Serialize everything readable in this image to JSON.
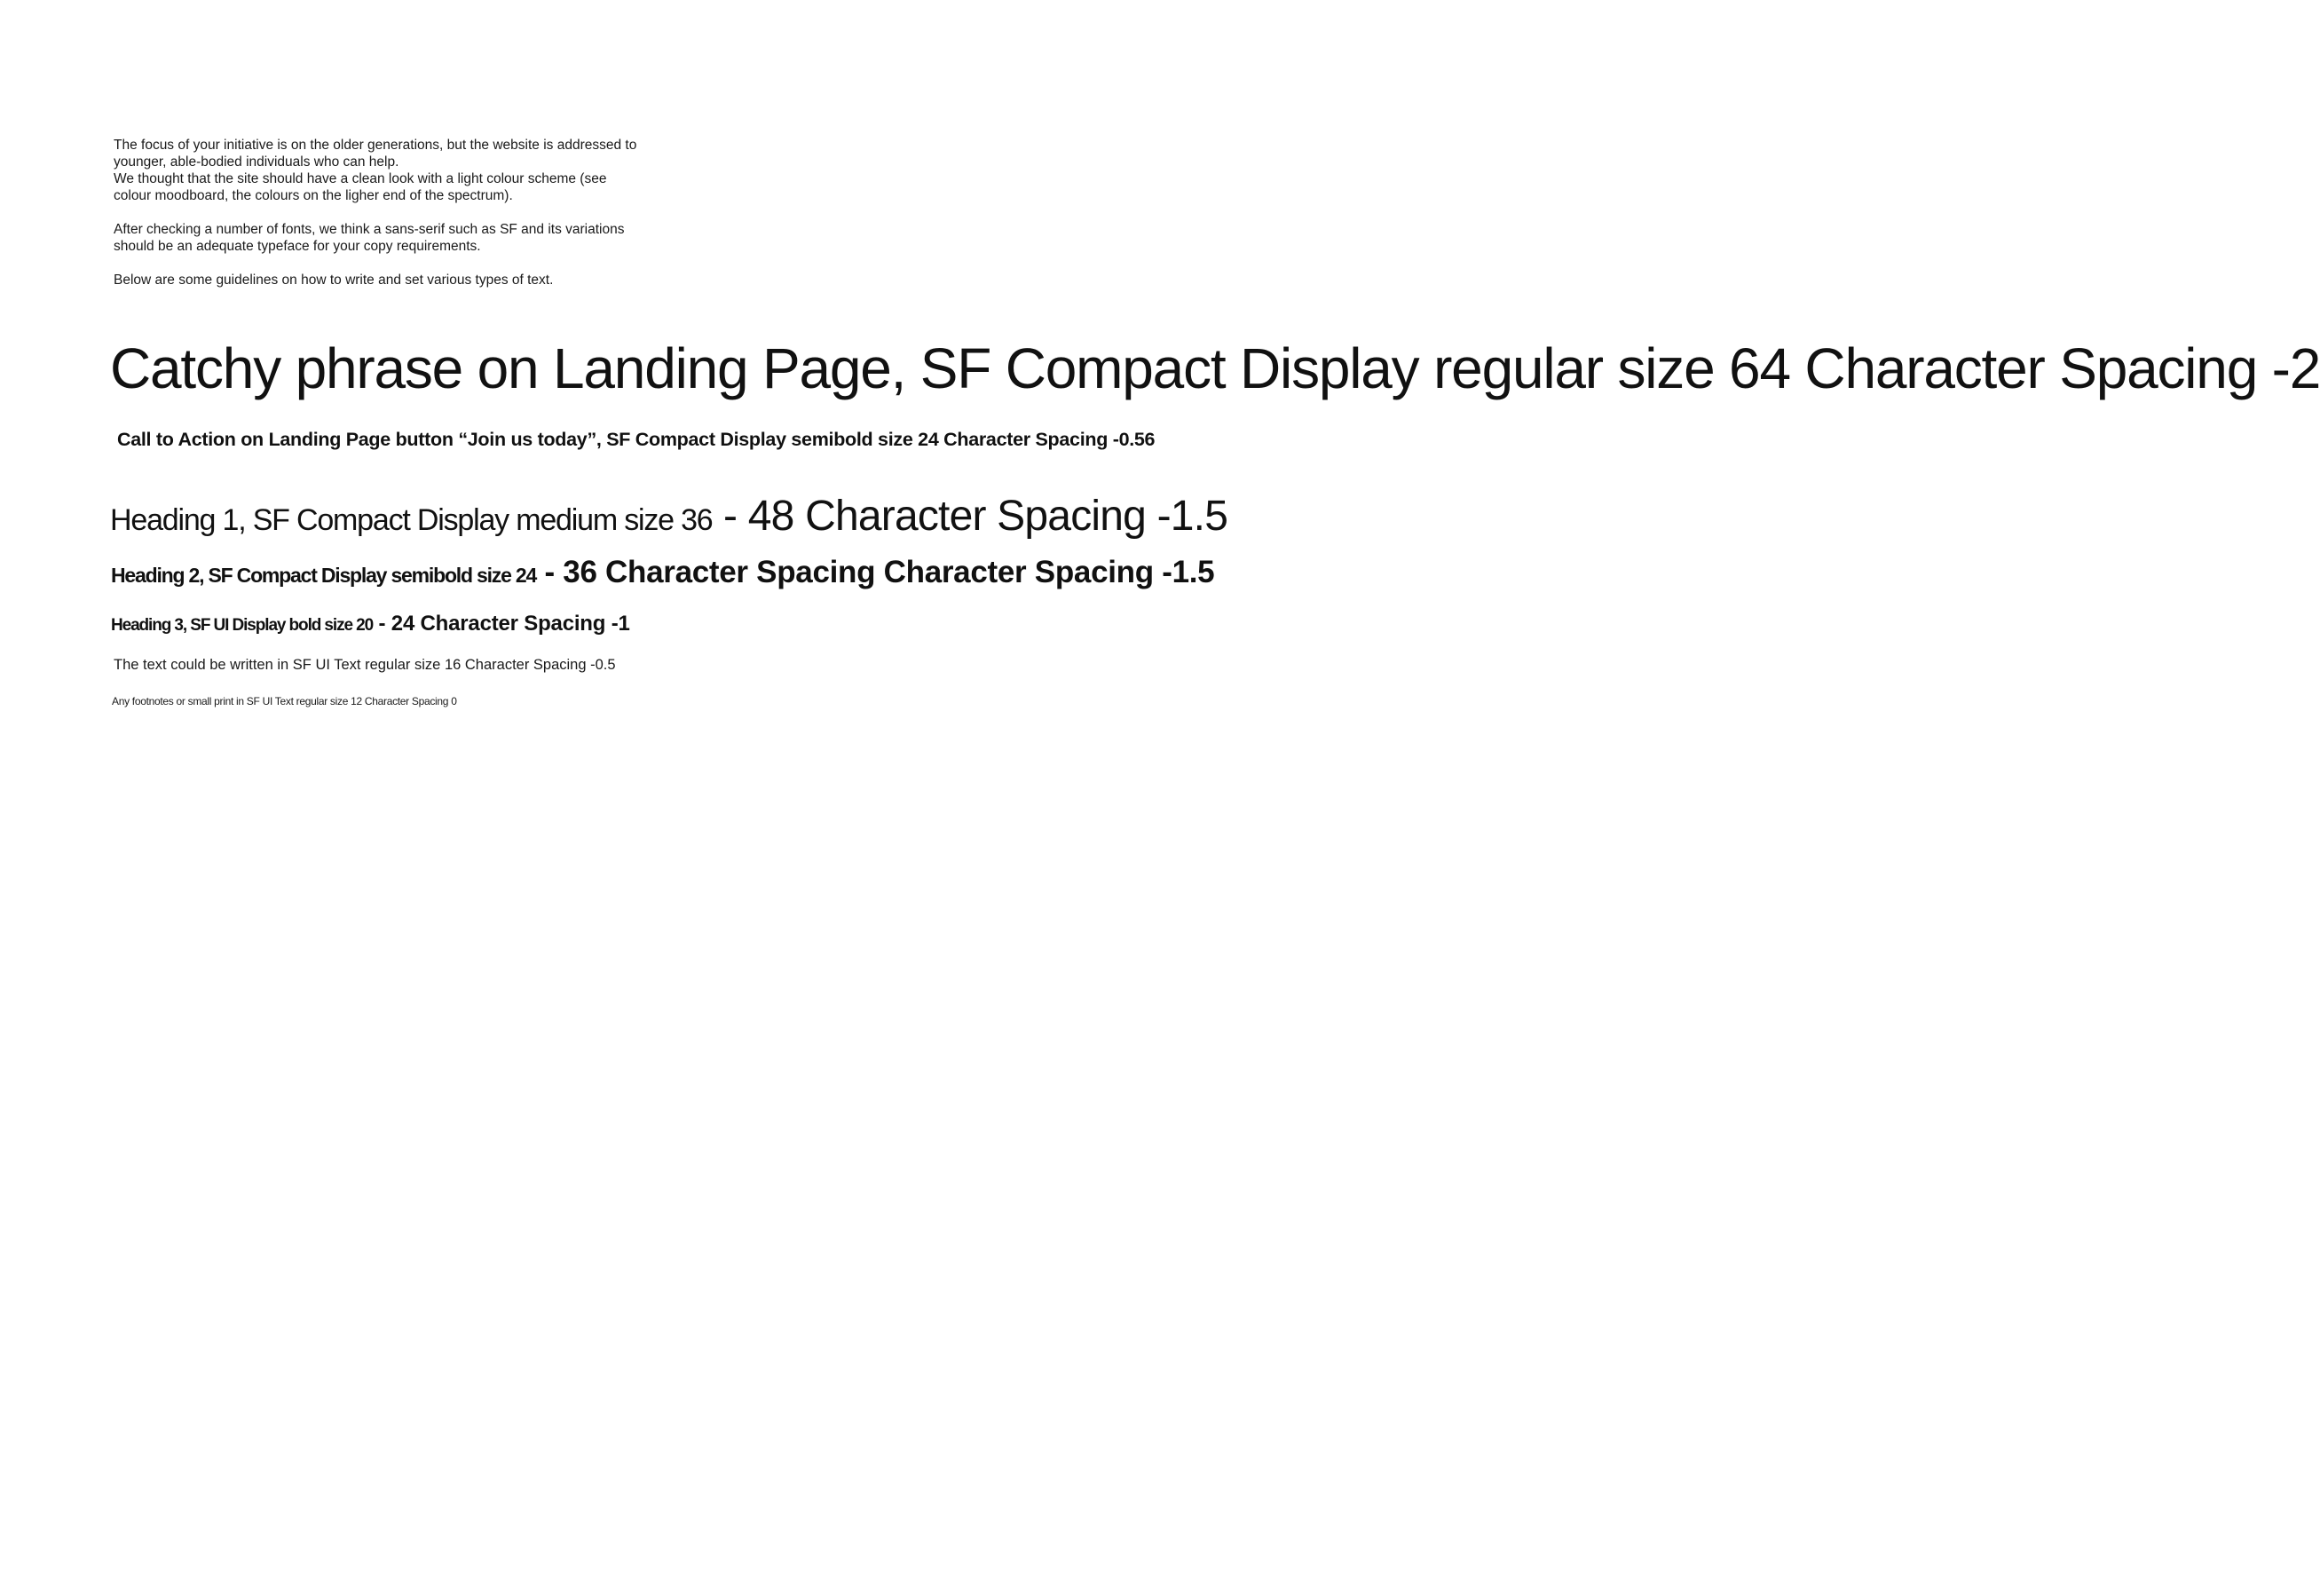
{
  "intro": {
    "lines": [
      "The focus of your initiative is on the older generations, but the website is addressed to",
      "younger, able-bodied individuals who can help.",
      "We thought that the site should have a clean look with a light colour scheme (see",
      "colour moodboard, the colours on the ligher end of the spectrum).",
      "After checking a number of fonts, we think a sans-serif such as SF and its variations",
      "should be an adequate typeface for your copy requirements.",
      "Below are some guidelines on how to write and set various types of text."
    ]
  },
  "samples": {
    "catchy": "Catchy phrase on Landing Page, SF Compact Display regular size 64 Character Spacing -2",
    "cta": "Call to Action on Landing Page button “Join us today”, SF Compact Display semibold size 24 Character Spacing -0.56",
    "heading1": {
      "part1": "Heading 1, SF Compact Display medium size 36",
      "part2": " - 48 Character Spacing -1.5"
    },
    "heading2": {
      "part1": "Heading 2, SF Compact Display semibold size 24",
      "part2": "  - 36 Character Spacing Character Spacing -1.5"
    },
    "heading3": {
      "part1": "Heading 3, SF UI Display bold size  20",
      "part2": " - 24 Character Spacing -1"
    },
    "body": "The text could be written in SF UI Text regular size 16 Character Spacing -0.5",
    "footnote": "Any footnotes or small print in SF UI Text regular size 12 Character Spacing 0"
  }
}
